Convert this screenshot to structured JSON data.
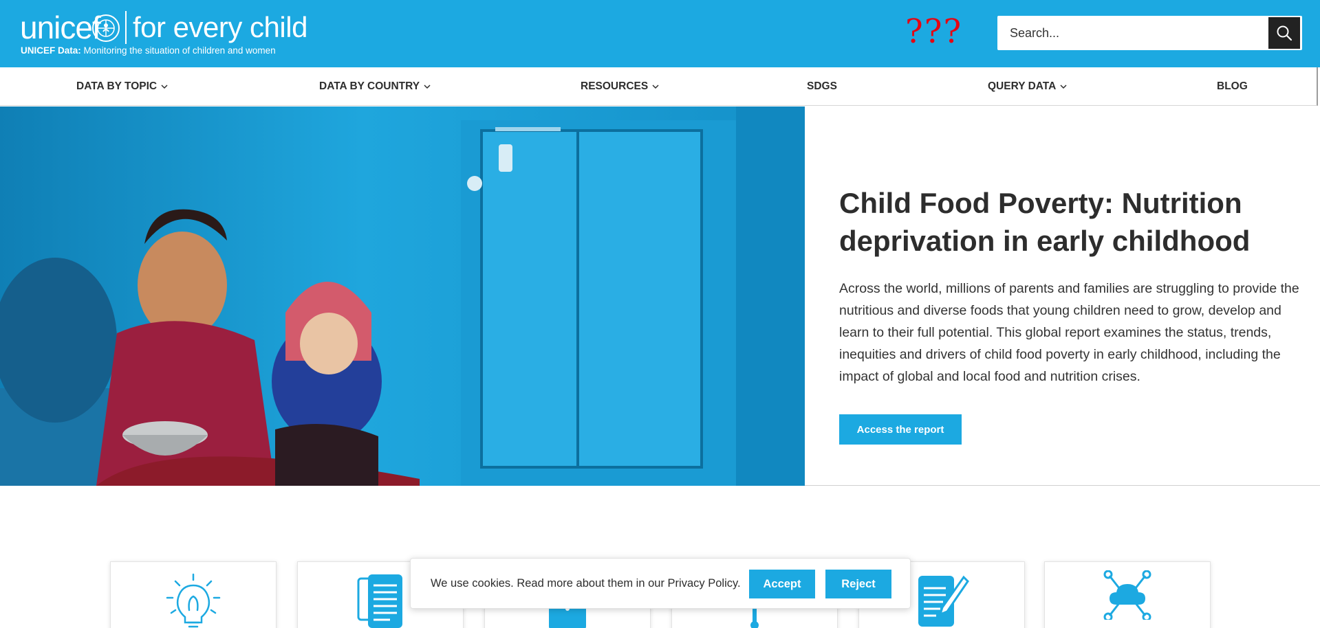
{
  "header": {
    "logo_word": "unicef",
    "logo_tagline": "for every child",
    "subtitle_bold": "UNICEF Data:",
    "subtitle_rest": " Monitoring the situation of children and women",
    "placeholder_marks": "???",
    "search_placeholder": "Search...",
    "colors": {
      "brand": "#1ca9e1",
      "marks": "#e30613"
    }
  },
  "nav": {
    "items": [
      {
        "label": "DATA BY TOPIC",
        "has_dropdown": true
      },
      {
        "label": "DATA BY COUNTRY",
        "has_dropdown": true
      },
      {
        "label": "RESOURCES",
        "has_dropdown": true
      },
      {
        "label": "SDGS",
        "has_dropdown": false
      },
      {
        "label": "QUERY DATA",
        "has_dropdown": true
      },
      {
        "label": "BLOG",
        "has_dropdown": false
      }
    ]
  },
  "hero": {
    "image_desc": "woman-feeding-baby-photo",
    "title": "Child Food Poverty: Nutrition deprivation in early childhood",
    "description": "Across the world, millions of parents and families are struggling to provide the nutritious and diverse foods that young children need to grow, develop and learn to their full potential. This global report examines the status, trends, inequities and drivers of child food poverty in early childhood, including the impact of global and local food and nutrition crises.",
    "button_label": "Access the report"
  },
  "cards": [
    {
      "icon": "lightbulb-icon"
    },
    {
      "icon": "documents-icon"
    },
    {
      "icon": "clipboard-icon"
    },
    {
      "icon": "thermometer-icon"
    },
    {
      "icon": "document-pencil-icon"
    },
    {
      "icon": "cloud-network-icon"
    }
  ],
  "cookie": {
    "text": "We use cookies. Read more about them in our Privacy Policy.",
    "accept_label": "Accept",
    "reject_label": "Reject"
  }
}
